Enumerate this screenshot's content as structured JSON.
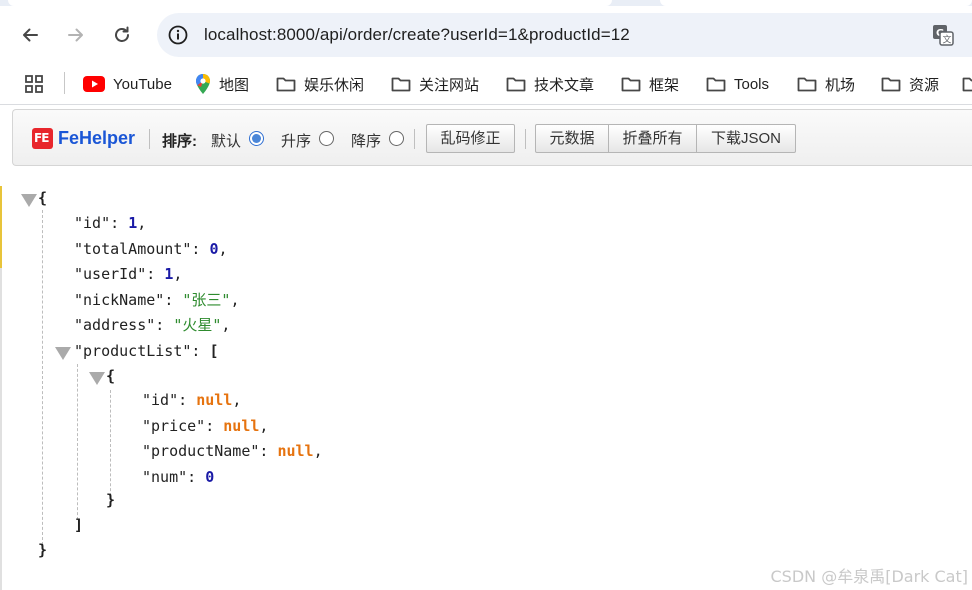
{
  "browser": {
    "url": "localhost:8000/api/order/create?userId=1&productId=12"
  },
  "bookmarks": {
    "items": [
      {
        "label": "YouTube",
        "icon": "youtube-icon"
      },
      {
        "label": "地图",
        "icon": "maps-pin-icon"
      },
      {
        "label": "娱乐休闲",
        "icon": "folder-icon"
      },
      {
        "label": "关注网站",
        "icon": "folder-icon"
      },
      {
        "label": "技术文章",
        "icon": "folder-icon"
      },
      {
        "label": "框架",
        "icon": "folder-icon"
      },
      {
        "label": "Tools",
        "icon": "folder-icon"
      },
      {
        "label": "机场",
        "icon": "folder-icon"
      },
      {
        "label": "资源",
        "icon": "folder-icon"
      }
    ]
  },
  "fehelper": {
    "logo_text": "FE",
    "brand": "FeHelper",
    "sort_label": "排序:",
    "sort_options": [
      {
        "label": "默认",
        "checked": true
      },
      {
        "label": "升序",
        "checked": false
      },
      {
        "label": "降序",
        "checked": false
      }
    ],
    "fix_encoding_button": "乱码修正",
    "buttons": [
      "元数据",
      "折叠所有",
      "下载JSON"
    ]
  },
  "json": {
    "open_brace": "{",
    "close_brace": "}",
    "fields": [
      {
        "key": "\"id\"",
        "value": "1",
        "type": "number"
      },
      {
        "key": "\"totalAmount\"",
        "value": "0",
        "type": "number"
      },
      {
        "key": "\"userId\"",
        "value": "1",
        "type": "number"
      },
      {
        "key": "\"nickName\"",
        "value": "\"张三\"",
        "type": "string"
      },
      {
        "key": "\"address\"",
        "value": "\"火星\"",
        "type": "string"
      }
    ],
    "list_key": "\"productList\"",
    "list_open": "[",
    "list_close": "]",
    "item_fields": [
      {
        "key": "\"id\"",
        "value": "null",
        "type": "null"
      },
      {
        "key": "\"price\"",
        "value": "null",
        "type": "null"
      },
      {
        "key": "\"productName\"",
        "value": "null",
        "type": "null"
      },
      {
        "key": "\"num\"",
        "value": "0",
        "type": "number"
      }
    ]
  },
  "watermark": "CSDN @牟泉禹[Dark Cat]",
  "colors": {
    "number": "#1a1aa6",
    "string": "#2e8b2e",
    "null": "#e6730f",
    "brand": "#1a56d6",
    "logo": "#e8262c"
  }
}
